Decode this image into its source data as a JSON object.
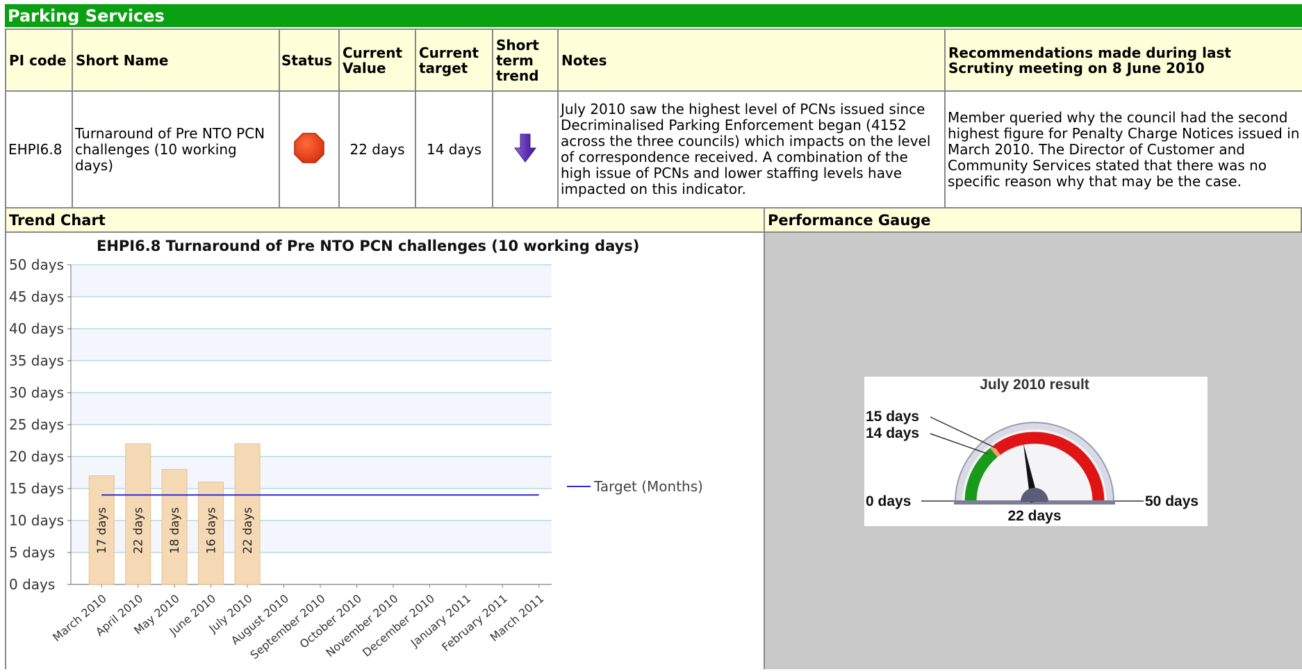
{
  "section_title": "Parking Services",
  "table": {
    "headers": {
      "pi_code": "PI code",
      "short_name": "Short Name",
      "status": "Status",
      "current_value": "Current Value",
      "current_target": "Current target",
      "short_term_trend": "Short term trend",
      "notes": "Notes",
      "recommendations": "Recommendations made during last Scrutiny meeting on 8 June 2010"
    },
    "row": {
      "pi_code": "EHPI6.8",
      "short_name": "Turnaround of Pre NTO PCN challenges (10 working days)",
      "status_icon": "red-octagon-icon",
      "current_value": "22 days",
      "current_target": "14 days",
      "trend_icon": "down-arrow-icon",
      "notes": "July 2010 saw the highest level of PCNs issued since Decriminalised Parking Enforcement began (4152 across the three councils) which impacts on the level of correspondence received. A combination of the high issue of PCNs and lower staffing levels have impacted on this indicator.",
      "recommendations": "Member queried why the council had the second highest figure for Penalty Charge Notices issued in March 2010. The Director of Customer and Community Services stated that there was no specific reason why that may be the case."
    }
  },
  "trend_chart_label": "Trend Chart",
  "performance_gauge_label": "Performance Gauge",
  "chart_data": {
    "type": "bar",
    "title": "EHPI6.8 Turnaround of Pre NTO PCN challenges (10 working days)",
    "categories": [
      "March 2010",
      "April 2010",
      "May 2010",
      "June 2010",
      "July 2010",
      "August 2010",
      "September 2010",
      "October 2010",
      "November 2010",
      "December 2010",
      "January 2011",
      "February 2011",
      "March 2011"
    ],
    "values": [
      17,
      22,
      18,
      16,
      22,
      null,
      null,
      null,
      null,
      null,
      null,
      null,
      null
    ],
    "bar_labels": [
      "17 days",
      "22 days",
      "18 days",
      "16 days",
      "22 days"
    ],
    "target": 14,
    "target_label": "Target (Months)",
    "ylim": [
      0,
      50
    ],
    "yticks": [
      0,
      5,
      10,
      15,
      20,
      25,
      30,
      35,
      40,
      45,
      50
    ],
    "ytick_labels": [
      "0 days",
      "5 days",
      "10 days",
      "15 days",
      "20 days",
      "25 days",
      "30 days",
      "35 days",
      "40 days",
      "45 days",
      "50 days"
    ],
    "legend_position": "right",
    "bar_color": "#f5d9b5",
    "target_color": "#2a2ad6",
    "grid": true
  },
  "gauge": {
    "title": "July 2010 result",
    "min_label": "0 days",
    "max_label": "50 days",
    "value_label": "22 days",
    "tick_a_label": "15 days",
    "tick_b_label": "14 days",
    "min": 0,
    "max": 50,
    "value": 22,
    "good_until": 14,
    "warn_until": 15,
    "colors": {
      "good": "#1a9a1a",
      "warn": "#f0a070",
      "bad": "#e01414"
    }
  }
}
